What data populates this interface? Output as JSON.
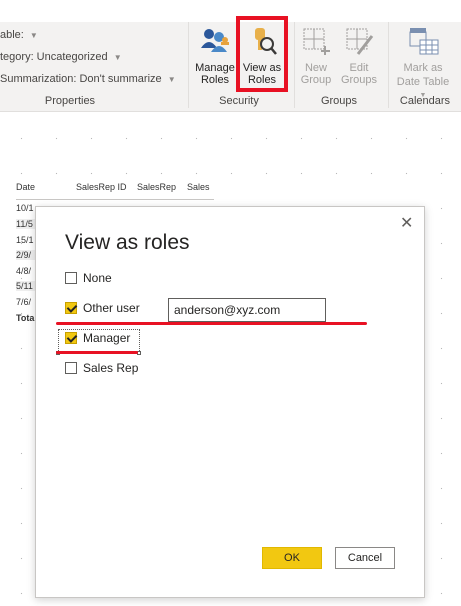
{
  "ribbon": {
    "properties": {
      "row1_label": "able:",
      "row2_label": "tegory: Uncategorized",
      "row3_label": "Summarization: Don't summarize",
      "group_label": "Properties"
    },
    "security": {
      "manage_roles_line1": "Manage",
      "manage_roles_line2": "Roles",
      "view_as_roles_line1": "View as",
      "view_as_roles_line2": "Roles",
      "group_label": "Security"
    },
    "groups": {
      "new_group_line1": "New",
      "new_group_line2": "Group",
      "edit_groups_line1": "Edit",
      "edit_groups_line2": "Groups",
      "group_label": "Groups"
    },
    "calendars": {
      "mark_as_line1": "Mark as",
      "mark_as_line2": "Date Table",
      "group_label": "Calendars"
    }
  },
  "table": {
    "headers": [
      "Date",
      "SalesRep ID",
      "SalesRep",
      "Sales"
    ],
    "rows": [
      "10/1",
      "11/5",
      "15/1",
      "2/9/",
      "4/8/",
      "5/11",
      "7/6/",
      "Tota"
    ]
  },
  "dialog": {
    "title": "View as roles",
    "close_glyph": "✕",
    "options": [
      {
        "label": "None",
        "checked": false
      },
      {
        "label": "Other user",
        "checked": true
      },
      {
        "label": "Manager",
        "checked": true
      },
      {
        "label": "Sales Rep",
        "checked": false
      }
    ],
    "other_user_value": "anderson@xyz.com",
    "ok_label": "OK",
    "cancel_label": "Cancel"
  },
  "colors": {
    "accent_yellow": "#f2c811",
    "annotation_red": "#e81123",
    "ribbon_bg": "#f3f2f1"
  }
}
